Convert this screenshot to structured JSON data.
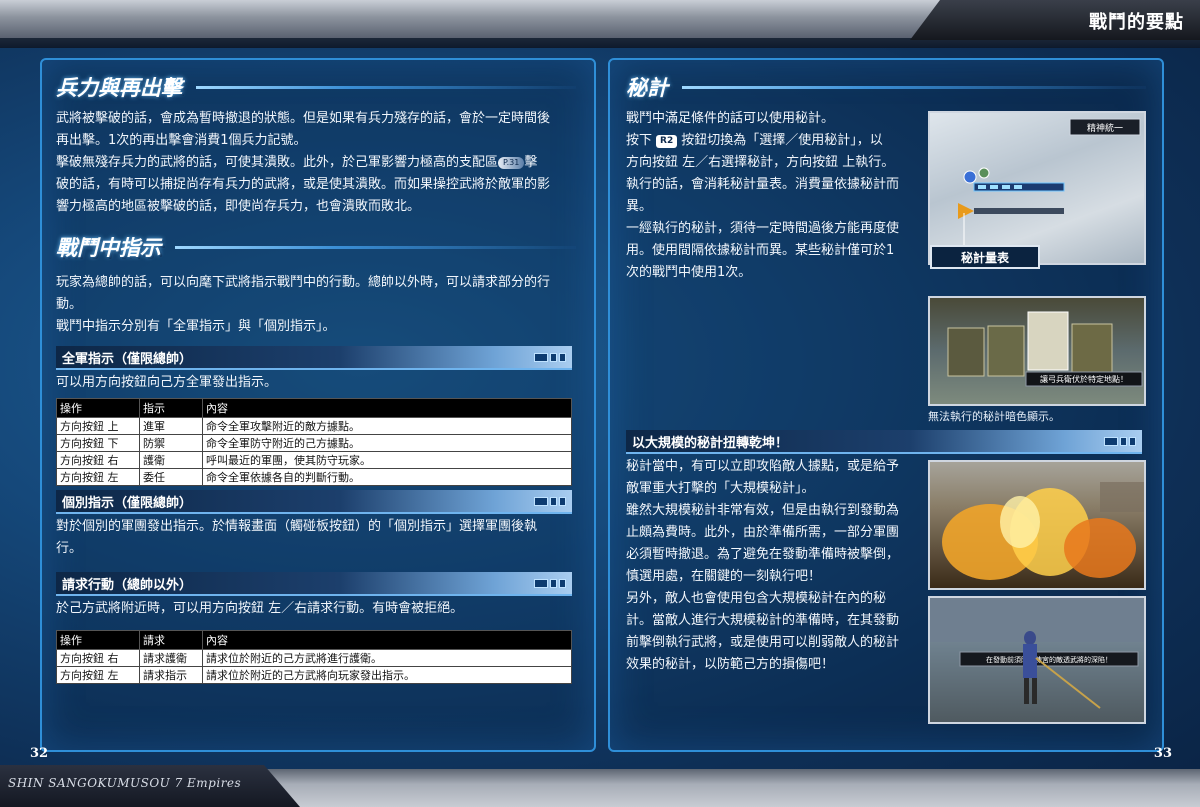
{
  "header": {
    "title": "戰鬥的要點"
  },
  "footer": {
    "game_title": "SHIN SANGOKUMUSOU 7 Empires",
    "page_left": "32",
    "page_right": "33"
  },
  "left": {
    "sec1": {
      "title": "兵力與再出擊",
      "lines": [
        "武將被擊破的話，會成為暫時撤退的狀態。但是如果有兵力殘存的話，會於一定時間後",
        "再出擊。1次的再出擊會消費1個兵力記號。",
        "擊破無殘存兵力的武將的話，可使其潰敗。此外，於己軍影響力極高的支配區",
        "擊",
        "破的話，有時可以捕捉尚存有兵力的武將，或是使其潰敗。而如果操控武將於敵軍的影",
        "響力極高的地區被擊破的話，即使尚存兵力，也會潰敗而敗北。"
      ],
      "page_ref": "P.31"
    },
    "sec2": {
      "title": "戰鬥中指示",
      "lines": [
        "玩家為總帥的話，可以向麾下武將指示戰鬥中的行動。總帥以外時，可以請求部分的行",
        "動。",
        "戰鬥中指示分別有「全軍指示」與「個別指示」。"
      ]
    },
    "sub1": {
      "title": "全軍指示（僅限總帥）",
      "text": "可以用方向按鈕向己方全軍發出指示。",
      "table": {
        "headers": [
          "操作",
          "指示",
          "內容"
        ],
        "rows": [
          [
            "方向按鈕 上",
            "進軍",
            "命令全軍攻擊附近的敵方據點。"
          ],
          [
            "方向按鈕 下",
            "防禦",
            "命令全軍防守附近的己方據點。"
          ],
          [
            "方向按鈕 右",
            "護衛",
            "呼叫最近的軍團，使其防守玩家。"
          ],
          [
            "方向按鈕 左",
            "委任",
            "命令全軍依據各自的判斷行動。"
          ]
        ]
      }
    },
    "sub2": {
      "title": "個別指示（僅限總帥）",
      "lines": [
        "對於個別的軍團發出指示。於情報畫面（觸碰板按鈕）的「個別指示」選擇軍團後執",
        "行。"
      ]
    },
    "sub3": {
      "title": "請求行動（總帥以外）",
      "text": "於己方武將附近時，可以用方向按鈕 左／右請求行動。有時會被拒絕。",
      "table": {
        "headers": [
          "操作",
          "請求",
          "內容"
        ],
        "rows": [
          [
            "方向按鈕 右",
            "請求護衛",
            "請求位於附近的己方武將進行護衛。"
          ],
          [
            "方向按鈕 左",
            "請求指示",
            "請求位於附近的己方武將向玩家發出指示。"
          ]
        ]
      }
    }
  },
  "right": {
    "sec1": {
      "title": "秘計",
      "line1": "戰鬥中滿足條件的話可以使用秘計。",
      "line2_pre": "按下",
      "button": "R2",
      "line2_post": "按鈕切換為「選擇／使用秘計」，以",
      "lines_rest": [
        "方向按鈕 左／右選擇秘計，方向按鈕 上執行。",
        "執行的話，會消耗秘計量表。消費量依據秘計而",
        "異。",
        "一經執行的秘計，須待一定時間過後方能再度使",
        "用。使用間隔依據秘計而異。某些秘計僅可於1",
        "次的戰鬥中使用1次。"
      ],
      "callout": "秘計量表",
      "caption": "無法執行的秘計暗色顯示。"
    },
    "sub1": {
      "title": "以大規模的秘計扭轉乾坤！",
      "lines": [
        "秘計當中，有可以立即攻陷敵人據點，或是給予",
        "敵軍重大打擊的「大規模秘計」。",
        "雖然大規模秘計非常有效，但是由執行到發動為",
        "止頗為費時。此外，由於準備所需，一部分軍團",
        "必須暫時撤退。為了避免在發動準備時被擊倒，",
        "慎選用處，在關鍵的一刻執行吧！",
        "另外，敵人也會使用包含大規模秘計在內的秘",
        "計。當敵人進行大規模秘計的準備時，在其發動",
        "前擊倒執行武將，或是使用可以削弱敵人的秘計",
        "效果的秘計，以防範己方的損傷吧！"
      ]
    },
    "screens": {
      "shot1_label": "精神統一",
      "shot2_msg": "讓弓兵衛伏於特定地點！",
      "shot4_msg": "在發動前須防守陳宮的敵透武將的深陷！"
    }
  },
  "colors": {
    "accent": "#2f8fd8",
    "background": "#15487a"
  }
}
